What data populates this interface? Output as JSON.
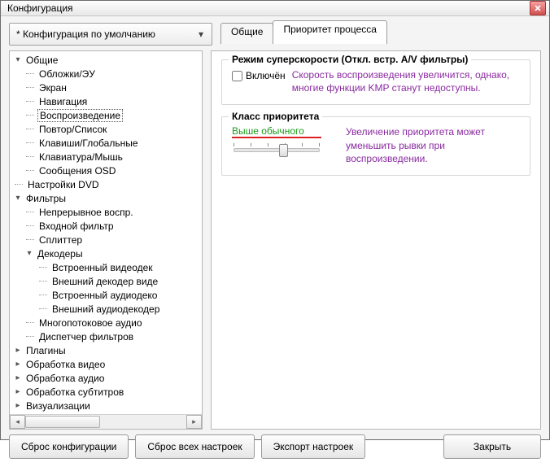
{
  "window": {
    "title": "Конфигурация"
  },
  "preset": {
    "label": "* Конфигурация по умолчанию"
  },
  "tabs": [
    {
      "id": "general",
      "label": "Общие",
      "active": false
    },
    {
      "id": "priority",
      "label": "Приоритет процесса",
      "active": true
    }
  ],
  "tree": {
    "items": [
      {
        "depth": 0,
        "expander": "▾",
        "label": "Общие"
      },
      {
        "depth": 1,
        "expander": "",
        "label": "Обложки/ЭУ"
      },
      {
        "depth": 1,
        "expander": "",
        "label": "Экран"
      },
      {
        "depth": 1,
        "expander": "",
        "label": "Навигация"
      },
      {
        "depth": 1,
        "expander": "",
        "label": "Воспроизведение",
        "selected": true,
        "underlined": true
      },
      {
        "depth": 1,
        "expander": "",
        "label": "Повтор/Список"
      },
      {
        "depth": 1,
        "expander": "",
        "label": "Клавиши/Глобальные"
      },
      {
        "depth": 1,
        "expander": "",
        "label": "Клавиатура/Мышь"
      },
      {
        "depth": 1,
        "expander": "",
        "label": "Сообщения OSD"
      },
      {
        "depth": 0,
        "expander": "",
        "label": "Настройки DVD"
      },
      {
        "depth": 0,
        "expander": "▾",
        "label": "Фильтры"
      },
      {
        "depth": 1,
        "expander": "",
        "label": "Непрерывное воспр."
      },
      {
        "depth": 1,
        "expander": "",
        "label": "Входной фильтр"
      },
      {
        "depth": 1,
        "expander": "",
        "label": "Сплиттер"
      },
      {
        "depth": 1,
        "expander": "▾",
        "label": "Декодеры"
      },
      {
        "depth": 2,
        "expander": "",
        "label": "Встроенный видеодек"
      },
      {
        "depth": 2,
        "expander": "",
        "label": "Внешний декодер виде"
      },
      {
        "depth": 2,
        "expander": "",
        "label": "Встроенный аудиодеко"
      },
      {
        "depth": 2,
        "expander": "",
        "label": "Внешний аудиодекодер"
      },
      {
        "depth": 1,
        "expander": "",
        "label": "Многопотоковое аудио"
      },
      {
        "depth": 1,
        "expander": "",
        "label": "Диспетчер фильтров"
      },
      {
        "depth": 0,
        "expander": "▸",
        "label": "Плагины"
      },
      {
        "depth": 0,
        "expander": "▸",
        "label": "Обработка видео"
      },
      {
        "depth": 0,
        "expander": "▸",
        "label": "Обработка аудио"
      },
      {
        "depth": 0,
        "expander": "▸",
        "label": "Обработка субтитров"
      },
      {
        "depth": 0,
        "expander": "▸",
        "label": "Визуализации"
      }
    ]
  },
  "content": {
    "superspeed": {
      "title": "Режим суперскорости (Откл. встр. A/V фильтры)",
      "checkbox_label": "Включён",
      "note": "Скорость воспроизведения увеличится, однако, многие функции KMP станут недоступны."
    },
    "priority": {
      "title": "Класс приоритета",
      "value": "Выше обычного",
      "note": "Увеличение приоритета может уменьшить рывки при воспроизведении."
    }
  },
  "footer": {
    "reset_config": "Сброс конфигурации",
    "reset_all": "Сброс всех настроек",
    "export": "Экспорт настроек",
    "close": "Закрыть"
  }
}
